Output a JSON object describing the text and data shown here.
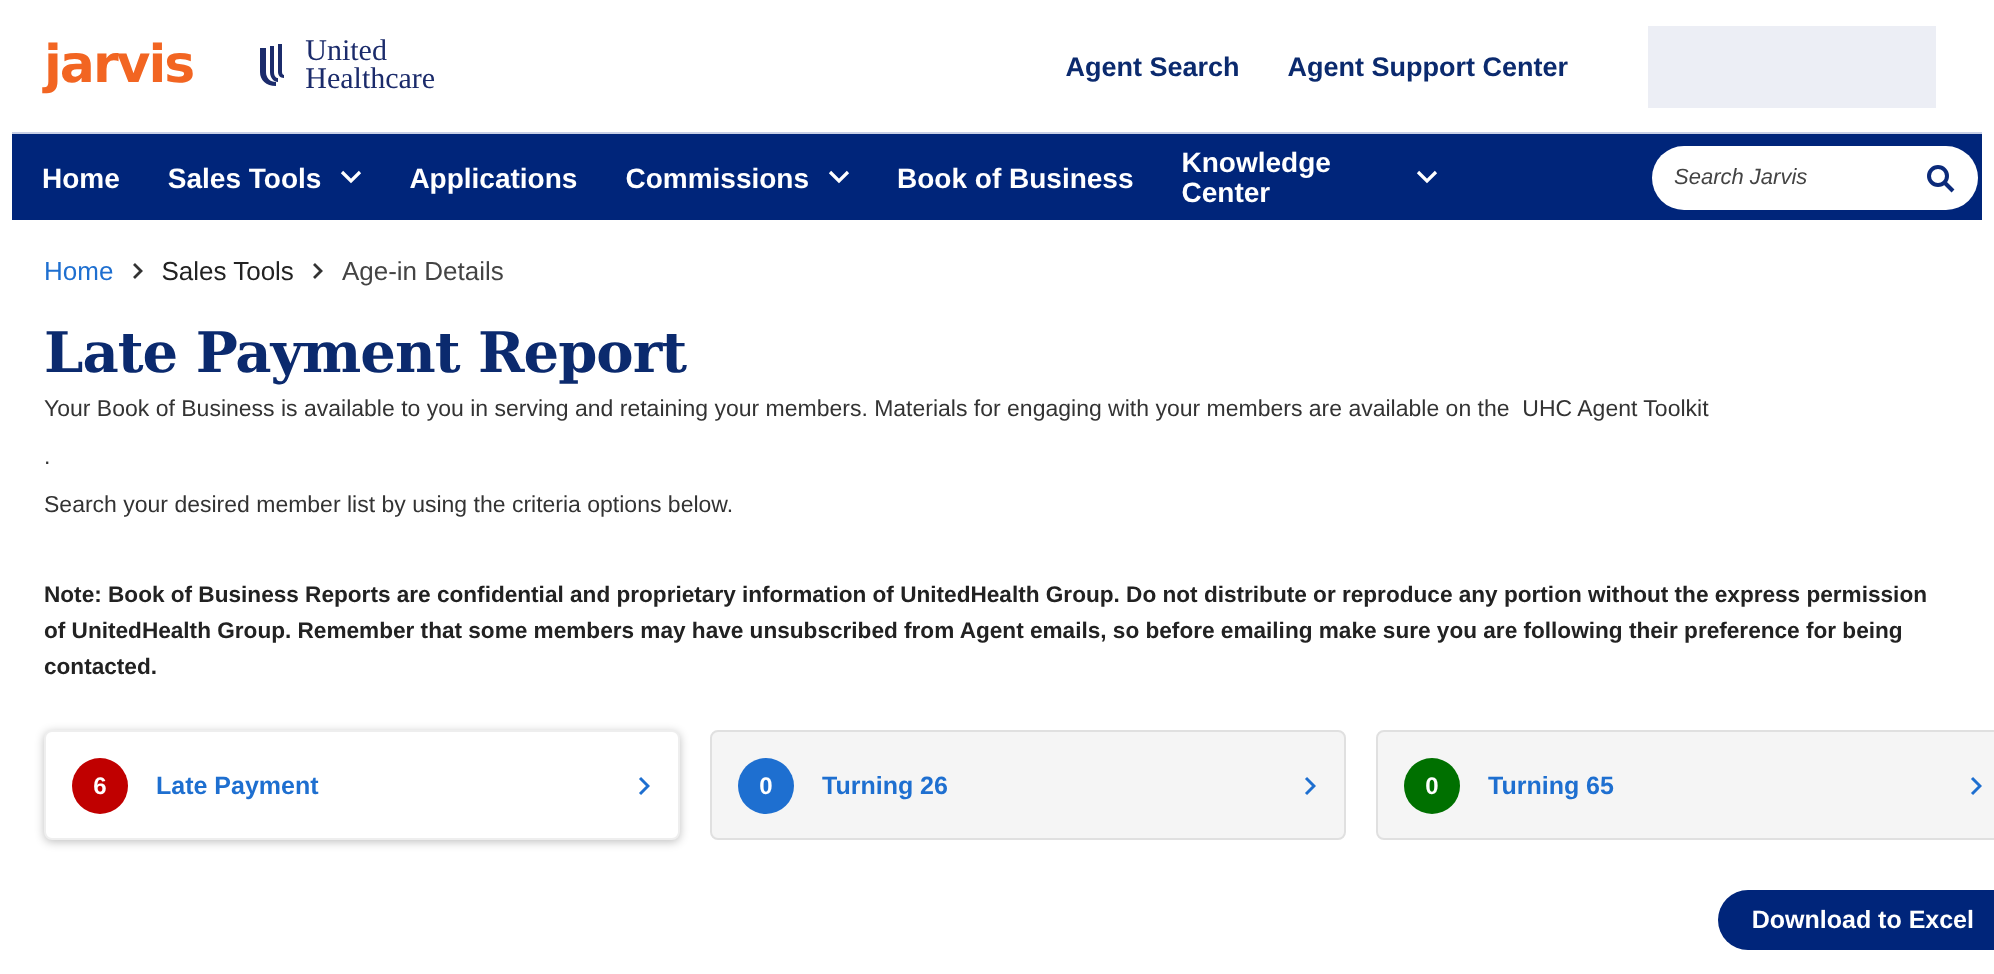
{
  "header": {
    "logo": "jarvis",
    "partner_logo": [
      "United",
      "Healthcare"
    ],
    "links": [
      "Agent Search",
      "Agent Support Center"
    ]
  },
  "nav": {
    "items": [
      {
        "label": "Home",
        "dropdown": false
      },
      {
        "label": "Sales Tools",
        "dropdown": true
      },
      {
        "label": "Applications",
        "dropdown": false
      },
      {
        "label": "Commissions",
        "dropdown": true
      },
      {
        "label": "Book of Business",
        "dropdown": false
      },
      {
        "label": "Knowledge Center",
        "dropdown": true
      }
    ],
    "search": {
      "placeholder": "Search Jarvis"
    }
  },
  "breadcrumb": [
    {
      "label": "Home",
      "link": true
    },
    {
      "label": "Sales Tools",
      "link": false
    },
    {
      "label": "Age-in Details",
      "link": false
    }
  ],
  "title": "Late Payment Report",
  "intro": "Your Book of Business is available to you in serving and retaining your members. Materials for engaging with your members are available on the  UHC Agent Toolkit",
  "intro_dot": ".",
  "instruction": "Search your desired member list by using the criteria options below.",
  "note": "Note: Book of Business Reports are confidential and proprietary information of UnitedHealth Group. Do not distribute or reproduce any portion without the express permission of UnitedHealth Group. Remember that some members may have unsubscribed from Agent emails, so before emailing make sure you are following their preference for being contacted.",
  "cards": [
    {
      "count": "6",
      "label": "Late Payment",
      "color": "#c00000",
      "selected": true
    },
    {
      "count": "0",
      "label": "Turning 26",
      "color": "#1e6fd0",
      "selected": false
    },
    {
      "count": "0",
      "label": "Turning 65",
      "color": "#007000",
      "selected": false
    }
  ],
  "download_button": "Download to Excel"
}
